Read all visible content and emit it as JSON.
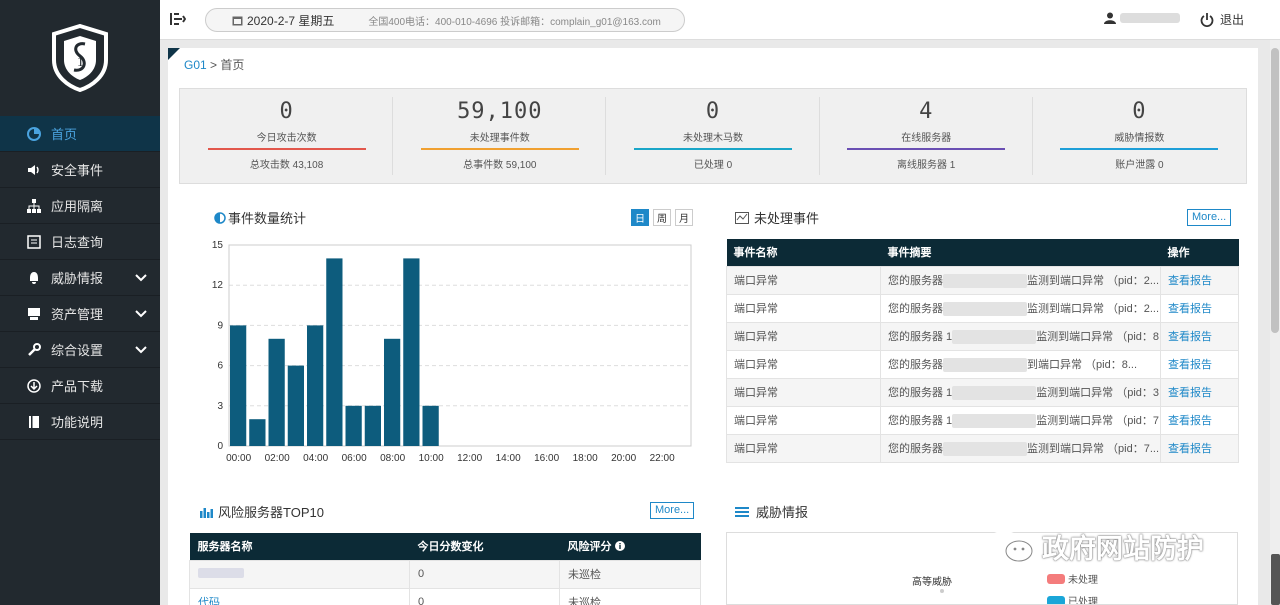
{
  "topbar": {
    "date": "2020-2-7 星期五",
    "contact": "全国400电话：400-010-4696  投诉邮箱：complain_g01@163.com",
    "logout": "退出"
  },
  "sidebar": {
    "items": [
      {
        "label": "首页",
        "icon": "pie-icon",
        "active": true
      },
      {
        "label": "安全事件",
        "icon": "speaker-icon"
      },
      {
        "label": "应用隔离",
        "icon": "sitemap-icon"
      },
      {
        "label": "日志查询",
        "icon": "log-icon"
      },
      {
        "label": "威胁情报",
        "icon": "bell-icon",
        "expandable": true
      },
      {
        "label": "资产管理",
        "icon": "server-icon",
        "expandable": true
      },
      {
        "label": "综合设置",
        "icon": "wrench-icon",
        "expandable": true
      },
      {
        "label": "产品下载",
        "icon": "download-icon"
      },
      {
        "label": "功能说明",
        "icon": "book-icon"
      }
    ]
  },
  "breadcrumb": {
    "root": "G01",
    "sep": ">",
    "current": "首页"
  },
  "stats": [
    {
      "value": "0",
      "label": "今日攻击次数",
      "sub": "总攻击数 43,108",
      "color": "#e2574c"
    },
    {
      "value": "59,100",
      "label": "未处理事件数",
      "sub": "总事件数 59,100",
      "color": "#f0a030"
    },
    {
      "value": "0",
      "label": "未处理木马数",
      "sub": "已处理 0",
      "color": "#1aa6c8"
    },
    {
      "value": "4",
      "label": "在线服务器",
      "sub": "离线服务器 1",
      "color": "#6a4fb3"
    },
    {
      "value": "0",
      "label": "威胁情报数",
      "sub": "账户泄露 0",
      "color": "#1e9fd8"
    }
  ],
  "event_chart": {
    "title": "事件数量统计",
    "tabs": [
      "日",
      "周",
      "月"
    ],
    "active_tab": "日"
  },
  "chart_data": {
    "type": "bar",
    "categories": [
      "00:00",
      "01:00",
      "02:00",
      "03:00",
      "04:00",
      "05:00",
      "06:00",
      "07:00",
      "08:00",
      "09:00",
      "10:00",
      "11:00",
      "12:00",
      "13:00",
      "14:00",
      "15:00",
      "16:00",
      "17:00",
      "18:00",
      "19:00",
      "20:00",
      "21:00",
      "22:00",
      "23:00"
    ],
    "values": [
      9,
      2,
      8,
      6,
      9,
      14,
      3,
      3,
      8,
      14,
      3,
      0,
      0,
      0,
      0,
      0,
      0,
      0,
      0,
      0,
      0,
      0,
      0,
      0
    ],
    "xtick_labels": [
      "00:00",
      "02:00",
      "04:00",
      "06:00",
      "08:00",
      "10:00",
      "12:00",
      "14:00",
      "16:00",
      "18:00",
      "20:00",
      "22:00"
    ],
    "yticks": [
      "0",
      "3",
      "6",
      "9",
      "12",
      "15"
    ],
    "ylim": [
      0,
      15
    ],
    "grid": true,
    "bar_color": "#0d5c7d"
  },
  "unhandled": {
    "title": "未处理事件",
    "more": "More...",
    "columns": [
      "事件名称",
      "事件摘要",
      "操作"
    ],
    "rows": [
      {
        "name": "端口异常",
        "pre": "您的服务器",
        "post": "监测到端口异常 （pid：2...",
        "action": "查看报告"
      },
      {
        "name": "端口异常",
        "pre": "您的服务器",
        "post": "监测到端口异常 （pid：2...",
        "action": "查看报告"
      },
      {
        "name": "端口异常",
        "pre": "您的服务器 1",
        "post": "监测到端口异常 （pid：8...",
        "action": "查看报告"
      },
      {
        "name": "端口异常",
        "pre": "您的服务器",
        "post": "到端口异常 （pid：8...",
        "action": "查看报告"
      },
      {
        "name": "端口异常",
        "pre": "您的服务器 1",
        "post": "监测到端口异常 （pid：3...",
        "action": "查看报告"
      },
      {
        "name": "端口异常",
        "pre": "您的服务器 1",
        "post": "监测到端口异常 （pid：7...",
        "action": "查看报告"
      },
      {
        "name": "端口异常",
        "pre": "您的服务器",
        "post": "监测到端口异常 （pid：7...",
        "action": "查看报告"
      }
    ]
  },
  "risk": {
    "title": "风险服务器TOP10",
    "more": "More...",
    "columns": [
      "服务器名称",
      "今日分数变化",
      "风险评分"
    ],
    "rows": [
      {
        "name": "",
        "change": "0",
        "score": "未巡检"
      },
      {
        "name": "代码",
        "change": "0",
        "score": "未巡检"
      }
    ]
  },
  "threat": {
    "title": "威胁情报",
    "radar_label": "高等威胁",
    "legend": [
      {
        "label": "未处理",
        "color": "#f47c7c"
      },
      {
        "label": "已处理",
        "color": "#1aa6d8"
      }
    ]
  },
  "watermark": "政府网站防护"
}
